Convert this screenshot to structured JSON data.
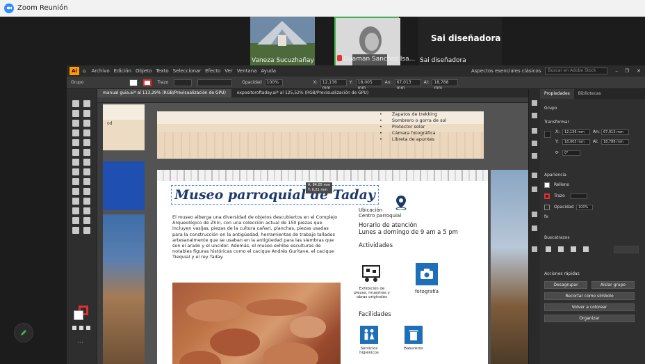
{
  "zoom": {
    "window_title": "Zoom Reunión",
    "participants": [
      {
        "name": "Vaneza Sucuzhañay"
      },
      {
        "name": "Guaman Sanchez Isa...",
        "muted": true
      },
      {
        "name": "Sai diseñadora",
        "big_name": "Sai diseñadora"
      }
    ]
  },
  "illustrator": {
    "menu": [
      "Archivo",
      "Edición",
      "Objeto",
      "Texto",
      "Seleccionar",
      "Efecto",
      "Ver",
      "Ventana",
      "Ayuda"
    ],
    "workspace": "Aspectos esenciales clásicos",
    "search_placeholder": "Buscar en Adobe Stock",
    "control": {
      "label": "Grupo",
      "trazo": "Trazo",
      "opacidad_label": "Opacidad",
      "opacidad_value": "100%",
      "x": "12,136 mm",
      "y": "18,005 mm",
      "w": "67,013 mm",
      "h": "18,788 mm"
    },
    "tabs": [
      "manual guia.ai* al 113,29% (RGB/Previsualización de GPU)",
      "expositoroftaday.ai* al 125,52% (RGB/Previsualización de GPU)"
    ],
    "selection_tag": {
      "line1": "A: 84,05 mm",
      "line2": "Y: 0,21 mm"
    },
    "page_top_list": [
      "Zapatos de trekking",
      "Sombrero o gorra de sol",
      "Protector solar",
      "Cámara fotográfica",
      "Libreta de apuntes"
    ],
    "doc": {
      "title": "Museo parroquial de Taday",
      "intro": "El museo alberga una diversidad de objetos descubiertos en el Complejo Arqueológico de Zhin, con una colección actual de 150 piezas que incluyen vasijas, piezas de la cultura cañari, planchas, piezas usadas para la construcción en la antigüedad, herramientas de trabajo tallados artesanalmente que se usaban en la antigüedad para las siembras que son el arado y el uncidor. Además, el museo exhibe esculturas de notables figuras históricas como el cacique Andrés Guritave, el cacique Tiequial y el rey Taday.",
      "ubicacion_label": "Ubicación",
      "ubicacion_value": "Centro parroquial",
      "horario_label": "Horario de atención",
      "horario_value": "Lunes a domingo de 9 am a 5 pm",
      "actividades_label": "Actividades",
      "act1_label": "Exhibición de piezas, muestras y obras originales",
      "act2_label": "fotografía",
      "facilidades_label": "Facilidades",
      "fac1_label": "Servicios higiénicos",
      "fac2_label": "Basureros"
    },
    "panel": {
      "tabs": [
        "Propiedades",
        "Bibliotecas"
      ],
      "grupo": "Grupo",
      "transformar": "Transformar",
      "x": "12,136 mm",
      "y": "18,005 mm",
      "w": "67,013 mm",
      "h": "18,788 mm",
      "angle": "0°",
      "apariencia": "Apariencia",
      "relleno": "Relleno",
      "trazo": "Trazo",
      "opacidad": "Opacidad",
      "opacidad_value": "100%",
      "fx": "fx",
      "buscatrazos": "Buscatrazos",
      "acciones": "Acciones rápidas",
      "desagrupar": "Desagrupar",
      "aislar": "Aislar grupo",
      "recolorear": "Volver a colorear",
      "ordenar": "Organizar",
      "convertir": "Recortar como símbolo"
    }
  }
}
